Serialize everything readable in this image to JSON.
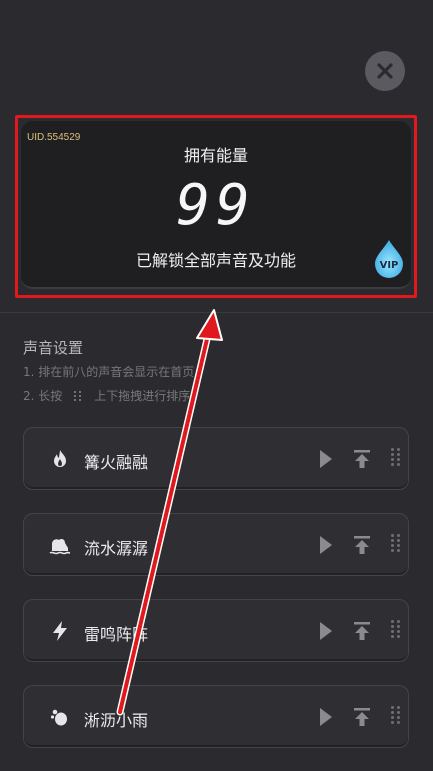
{
  "header": {
    "close_icon": "close-icon"
  },
  "energy": {
    "uid": "UID.554529",
    "label": "拥有能量",
    "value": "99",
    "description": "已解锁全部声音及功能",
    "badge": "VIP"
  },
  "settings": {
    "title": "声音设置",
    "hint1": "1. 排在前八的声音会显示在首页",
    "hint2_prefix": "2. 长按",
    "hint2_suffix": "上下拖拽进行排序"
  },
  "sounds": [
    {
      "name": "篝火融融",
      "icon": "fire-icon"
    },
    {
      "name": "流水潺潺",
      "icon": "water-icon"
    },
    {
      "name": "雷鸣阵阵",
      "icon": "lightning-icon"
    },
    {
      "name": "淅沥小雨",
      "icon": "rain-icon"
    }
  ],
  "colors": {
    "background": "#2b2b2f",
    "card": "#1f1f22",
    "highlight": "#e0191e",
    "vip": "#5ec8f0",
    "uid": "#d8c07a"
  }
}
